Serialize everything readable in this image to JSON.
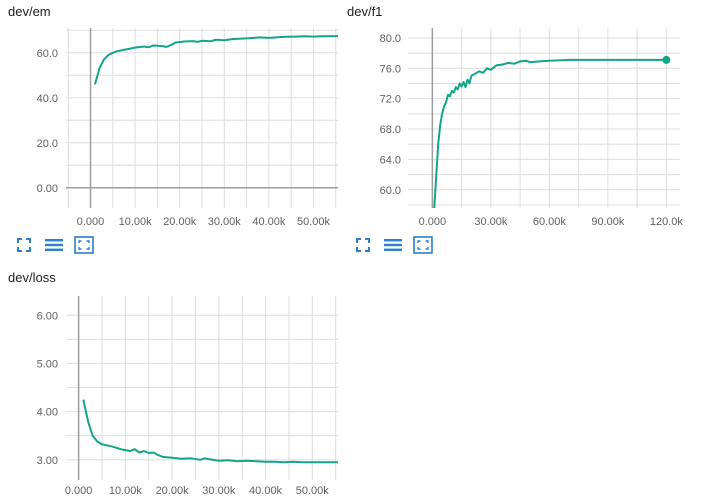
{
  "colors": {
    "line": "#12a58c",
    "grid": "#dedede",
    "axis_zero": "#9e9e9e",
    "icon": "#2a7fd0"
  },
  "toolbar_icons": [
    "expand-icon",
    "list-icon",
    "fit-domain-icon"
  ],
  "chart_data": [
    {
      "id": "em",
      "type": "line",
      "title": "dev/em",
      "xlim": [
        -5500,
        55500
      ],
      "ylim": [
        -9,
        71
      ],
      "x_ticks": [
        0,
        10000,
        20000,
        30000,
        40000,
        50000
      ],
      "x_tick_labels": [
        "0.000",
        "10.00k",
        "20.00k",
        "30.00k",
        "40.00k",
        "50.00k"
      ],
      "y_ticks": [
        0,
        20,
        40,
        60
      ],
      "y_tick_labels": [
        "0.00",
        "20.0",
        "40.0",
        "60.0"
      ],
      "grid": true,
      "series": [
        {
          "points": [
            [
              1000,
              46
            ],
            [
              2000,
              53
            ],
            [
              3000,
              57
            ],
            [
              4000,
              59
            ],
            [
              5000,
              60
            ],
            [
              6000,
              60.7
            ],
            [
              8000,
              61.5
            ],
            [
              10000,
              62.3
            ],
            [
              12000,
              62.8
            ],
            [
              13000,
              62.4
            ],
            [
              14000,
              63.2
            ],
            [
              16000,
              63.0
            ],
            [
              17000,
              62.6
            ],
            [
              18000,
              63.4
            ],
            [
              19000,
              64.5
            ],
            [
              21000,
              65.0
            ],
            [
              23000,
              65.2
            ],
            [
              24000,
              64.8
            ],
            [
              25000,
              65.3
            ],
            [
              27000,
              65.1
            ],
            [
              28000,
              65.8
            ],
            [
              30000,
              65.6
            ],
            [
              32000,
              66.1
            ],
            [
              34000,
              66.3
            ],
            [
              36000,
              66.5
            ],
            [
              38000,
              66.8
            ],
            [
              40000,
              66.6
            ],
            [
              42000,
              66.9
            ],
            [
              44000,
              67.1
            ],
            [
              46000,
              67.2
            ],
            [
              48000,
              67.3
            ],
            [
              50000,
              67.2
            ],
            [
              52000,
              67.3
            ],
            [
              55500,
              67.4
            ]
          ]
        }
      ]
    },
    {
      "id": "f1",
      "type": "line",
      "title": "dev/f1",
      "xlim": [
        -12500,
        127000
      ],
      "ylim": [
        57.6,
        81.3
      ],
      "x_ticks": [
        0,
        30000,
        60000,
        90000,
        120000
      ],
      "x_tick_labels": [
        "0.000",
        "30.00k",
        "60.00k",
        "90.00k",
        "120.0k"
      ],
      "y_ticks": [
        60,
        64,
        68,
        72,
        76,
        80
      ],
      "y_tick_labels": [
        "60.0",
        "64.0",
        "68.0",
        "72.0",
        "76.0",
        "80.0"
      ],
      "grid": true,
      "end_marker": true,
      "series": [
        {
          "points": [
            [
              1000,
              57.6
            ],
            [
              2000,
              62
            ],
            [
              3000,
              66
            ],
            [
              4000,
              68.5
            ],
            [
              5000,
              70
            ],
            [
              6000,
              71
            ],
            [
              7000,
              71.5
            ],
            [
              8000,
              72.5
            ],
            [
              9000,
              72.3
            ],
            [
              10000,
              73
            ],
            [
              11000,
              72.8
            ],
            [
              12000,
              73.5
            ],
            [
              13000,
              73.2
            ],
            [
              14000,
              74
            ],
            [
              15000,
              73.6
            ],
            [
              16000,
              74.2
            ],
            [
              17000,
              73.5
            ],
            [
              18000,
              74.5
            ],
            [
              19000,
              74
            ],
            [
              20000,
              75
            ],
            [
              22000,
              75.3
            ],
            [
              24000,
              75.6
            ],
            [
              26000,
              75.4
            ],
            [
              28000,
              76
            ],
            [
              30000,
              75.8
            ],
            [
              33000,
              76.4
            ],
            [
              36000,
              76.5
            ],
            [
              39000,
              76.7
            ],
            [
              42000,
              76.6
            ],
            [
              45000,
              76.9
            ],
            [
              48000,
              77.0
            ],
            [
              50000,
              76.8
            ],
            [
              55000,
              76.9
            ],
            [
              60000,
              77.0
            ],
            [
              70000,
              77.1
            ],
            [
              80000,
              77.1
            ],
            [
              90000,
              77.1
            ],
            [
              100000,
              77.1
            ],
            [
              110000,
              77.1
            ],
            [
              120000,
              77.1
            ]
          ]
        }
      ]
    },
    {
      "id": "loss",
      "type": "line",
      "title": "dev/loss",
      "xlim": [
        -2700,
        55500
      ],
      "ylim": [
        2.58,
        6.4
      ],
      "x_ticks": [
        0,
        10000,
        20000,
        30000,
        40000,
        50000
      ],
      "x_tick_labels": [
        "0.000",
        "10.00k",
        "20.00k",
        "30.00k",
        "40.00k",
        "50.00k"
      ],
      "y_ticks": [
        3,
        4,
        5,
        6
      ],
      "y_tick_labels": [
        "3.00",
        "4.00",
        "5.00",
        "6.00"
      ],
      "grid": true,
      "series": [
        {
          "points": [
            [
              1000,
              4.25
            ],
            [
              2000,
              3.8
            ],
            [
              3000,
              3.5
            ],
            [
              4000,
              3.38
            ],
            [
              5000,
              3.32
            ],
            [
              6000,
              3.3
            ],
            [
              7000,
              3.28
            ],
            [
              8000,
              3.25
            ],
            [
              9000,
              3.22
            ],
            [
              10000,
              3.2
            ],
            [
              11000,
              3.18
            ],
            [
              12000,
              3.22
            ],
            [
              13000,
              3.15
            ],
            [
              14000,
              3.18
            ],
            [
              15000,
              3.14
            ],
            [
              16000,
              3.15
            ],
            [
              17000,
              3.1
            ],
            [
              18000,
              3.06
            ],
            [
              20000,
              3.04
            ],
            [
              22000,
              3.02
            ],
            [
              24000,
              3.03
            ],
            [
              26000,
              3.0
            ],
            [
              27000,
              3.03
            ],
            [
              28000,
              3.01
            ],
            [
              30000,
              2.98
            ],
            [
              32000,
              2.99
            ],
            [
              34000,
              2.97
            ],
            [
              36000,
              2.98
            ],
            [
              38000,
              2.97
            ],
            [
              40000,
              2.96
            ],
            [
              42000,
              2.96
            ],
            [
              44000,
              2.95
            ],
            [
              46000,
              2.96
            ],
            [
              48000,
              2.95
            ],
            [
              50000,
              2.95
            ],
            [
              55500,
              2.95
            ]
          ]
        }
      ]
    }
  ]
}
